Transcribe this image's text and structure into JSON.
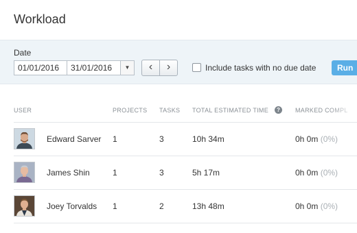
{
  "page": {
    "title": "Workload"
  },
  "filters": {
    "date_label": "Date",
    "start_date": "01/01/2016",
    "end_date": "31/01/2016",
    "include_no_due_label": "Include tasks with no due date",
    "include_no_due_checked": false,
    "run_label": "Run"
  },
  "table": {
    "headers": {
      "user": "USER",
      "projects": "PROJECTS",
      "tasks": "TASKS",
      "estimated": "TOTAL ESTIMATED TIME",
      "marked": "MARKED COMPL"
    },
    "rows": [
      {
        "name": "Edward Sarver",
        "projects": "1",
        "tasks": "3",
        "estimated": "10h 34m",
        "marked": "0h 0m",
        "marked_pct": "(0%)"
      },
      {
        "name": "James Shin",
        "projects": "1",
        "tasks": "3",
        "estimated": "5h 17m",
        "marked": "0h 0m",
        "marked_pct": "(0%)"
      },
      {
        "name": "Joey Torvalds",
        "projects": "1",
        "tasks": "2",
        "estimated": "13h 48m",
        "marked": "0h 0m",
        "marked_pct": "(0%)"
      }
    ]
  },
  "icons": {
    "dropdown": "chevron-down-icon",
    "prev": "chevron-left-icon",
    "next": "chevron-right-icon",
    "help": "help-icon"
  },
  "colors": {
    "run_button": "#5aaee6",
    "filter_bar": "#eef4f8"
  }
}
